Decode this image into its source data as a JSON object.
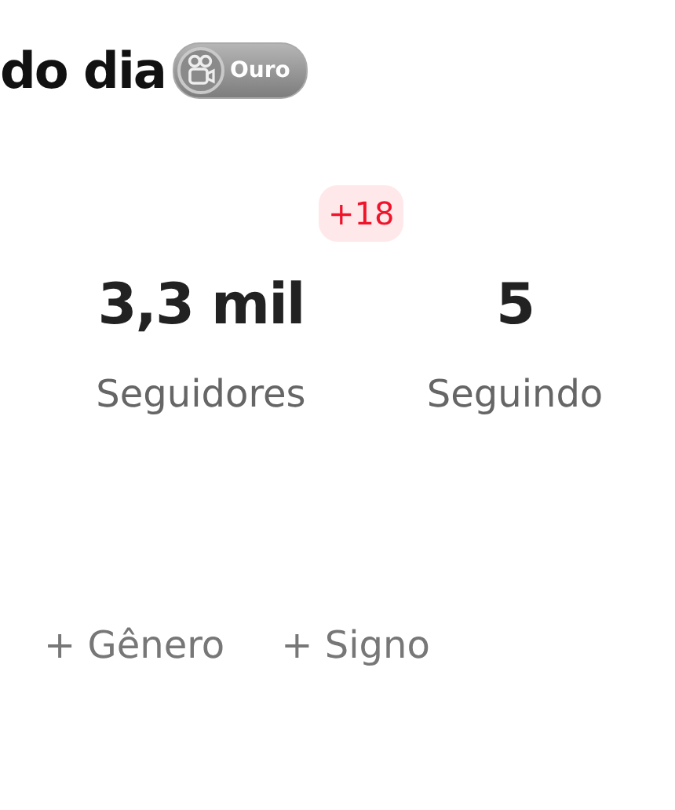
{
  "title": "do dia",
  "badge": {
    "label": "Ouro"
  },
  "stats": [
    {
      "value": "3,3 mil",
      "label": "Seguidores",
      "delta": "+18"
    },
    {
      "value": "5",
      "label": "Seguindo"
    }
  ],
  "tags": [
    {
      "label": "+ Gênero"
    },
    {
      "label": "+ Signo"
    }
  ]
}
